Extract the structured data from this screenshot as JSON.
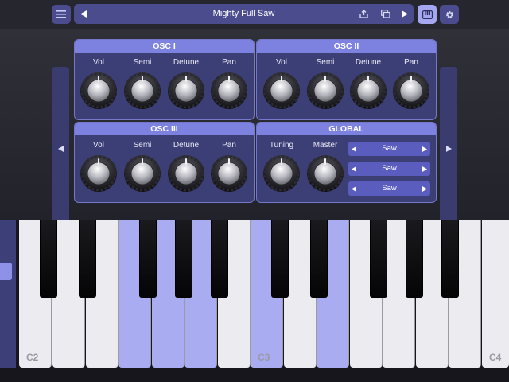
{
  "toolbar": {
    "menu_icon": "menu-icon",
    "preset_name": "Mighty Full Saw",
    "icons": [
      "prev-preset-icon",
      "save-icon",
      "duplicate-icon",
      "play-icon",
      "keyboard-icon",
      "gear-icon"
    ]
  },
  "panels": {
    "osc1": {
      "title": "OSC I",
      "knobs": [
        {
          "label": "Vol"
        },
        {
          "label": "Semi"
        },
        {
          "label": "Detune"
        },
        {
          "label": "Pan"
        }
      ]
    },
    "osc2": {
      "title": "OSC II",
      "knobs": [
        {
          "label": "Vol"
        },
        {
          "label": "Semi"
        },
        {
          "label": "Detune"
        },
        {
          "label": "Pan"
        }
      ]
    },
    "osc3": {
      "title": "OSC III",
      "knobs": [
        {
          "label": "Vol"
        },
        {
          "label": "Semi"
        },
        {
          "label": "Detune"
        },
        {
          "label": "Pan"
        }
      ]
    },
    "global": {
      "title": "GLOBAL",
      "knobs": [
        {
          "label": "Tuning"
        },
        {
          "label": "Master"
        }
      ],
      "waveforms": [
        {
          "value": "Saw"
        },
        {
          "value": "Saw"
        },
        {
          "value": "Saw"
        }
      ]
    }
  },
  "keyboard": {
    "labels": {
      "c2": "C2",
      "c3": "C3",
      "c4": "C4"
    },
    "highlight_color": "#a9acf0"
  },
  "colors": {
    "accent": "#7d81e0",
    "panel": "#3c3e76",
    "button": "#4a4c8e"
  }
}
